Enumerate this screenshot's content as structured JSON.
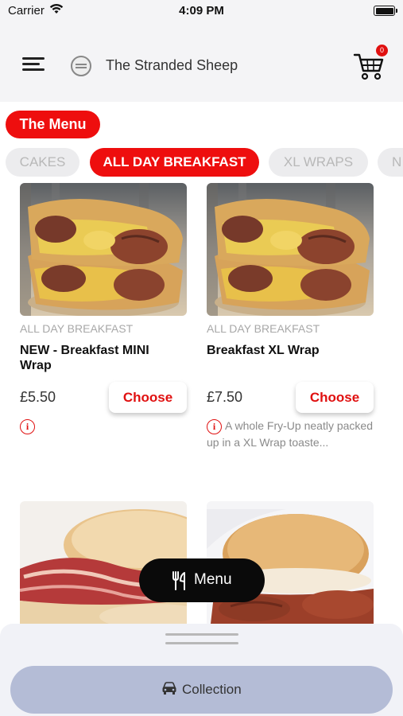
{
  "status_bar": {
    "carrier": "Carrier",
    "time": "4:09 PM"
  },
  "header": {
    "shop_name": "The Stranded Sheep",
    "cart_count": "0"
  },
  "menu_pill": "The Menu",
  "tabs": [
    {
      "label": "CAKES",
      "active": false
    },
    {
      "label": "ALL DAY BREAKFAST",
      "active": true
    },
    {
      "label": "XL WRAPS",
      "active": false
    },
    {
      "label": "N",
      "active": false
    }
  ],
  "items": [
    {
      "category": "ALL DAY BREAKFAST",
      "name": "NEW - Breakfast MINI Wrap",
      "price": "£5.50",
      "button": "Choose",
      "description": ""
    },
    {
      "category": "ALL DAY BREAKFAST",
      "name": "Breakfast XL Wrap",
      "price": "£7.50",
      "button": "Choose",
      "description": "A whole Fry-Up neatly packed up in a XL Wrap toaste..."
    }
  ],
  "floating_menu": {
    "label": "Menu",
    "icon": "fork-knife-icon"
  },
  "bottom_sheet": {
    "collection_label": "Collection",
    "icon": "car-icon"
  },
  "colors": {
    "accent": "#ee0e0e",
    "collection_button": "#b4bcd6",
    "floating_button": "#0a0a0a"
  }
}
